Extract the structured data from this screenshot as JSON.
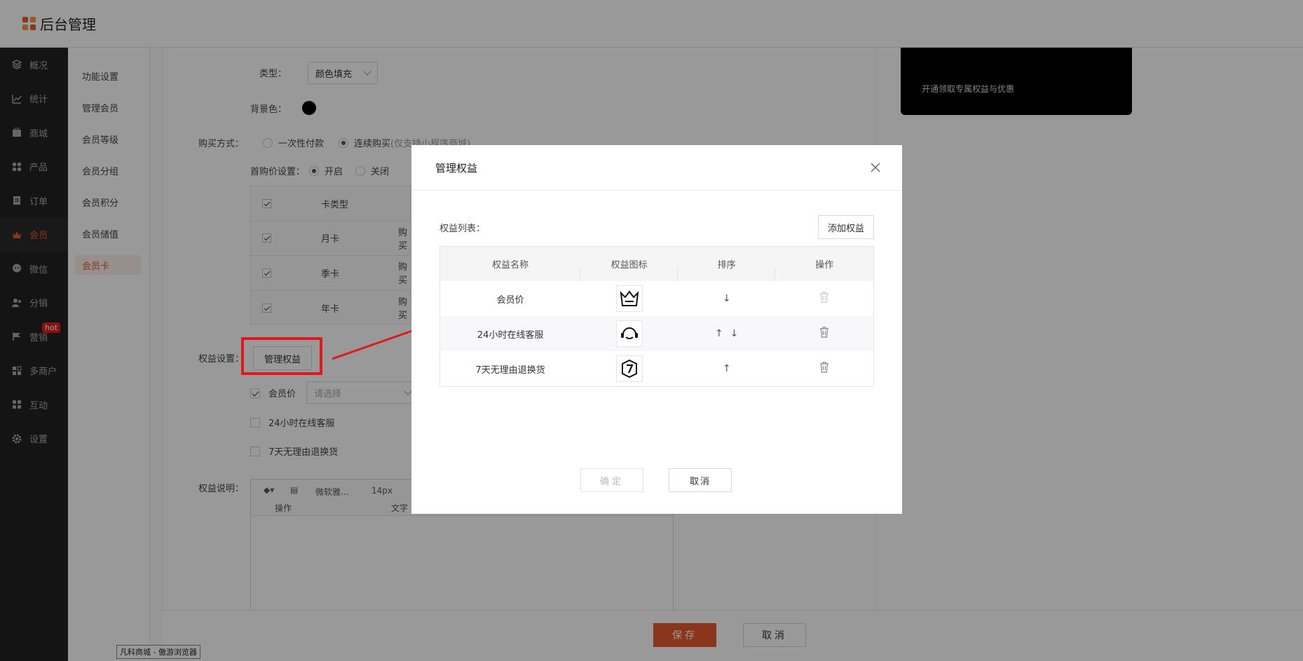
{
  "app": {
    "title": "后台管理"
  },
  "sidebar": {
    "items": [
      {
        "label": "概况",
        "icon": "layers-icon"
      },
      {
        "label": "统计",
        "icon": "chart-icon"
      },
      {
        "label": "商城",
        "icon": "shop-icon"
      },
      {
        "label": "产品",
        "icon": "grid-icon"
      },
      {
        "label": "订单",
        "icon": "order-icon"
      },
      {
        "label": "会员",
        "icon": "crown-icon",
        "active": true
      },
      {
        "label": "微信",
        "icon": "wechat-icon"
      },
      {
        "label": "分销",
        "icon": "users-icon"
      },
      {
        "label": "营销",
        "icon": "flag-icon",
        "badge": "hot"
      },
      {
        "label": "多商户",
        "icon": "merchants-icon"
      },
      {
        "label": "互动",
        "icon": "interact-icon"
      },
      {
        "label": "设置",
        "icon": "gear-icon"
      }
    ]
  },
  "subnav": {
    "items": [
      "功能设置",
      "管理会员",
      "会员等级",
      "会员分组",
      "会员积分",
      "会员储值",
      "会员卡"
    ]
  },
  "form": {
    "type_label": "类型：",
    "type_value": "颜色填充",
    "bg_label": "背景色：",
    "buy_label": "购买方式：",
    "buy_once": "一次性付款",
    "buy_continuous": "连续购买",
    "buy_hint": "(仅支持小程序商城)",
    "first_price_label": "首购价设置：",
    "first_on": "开启",
    "first_off": "关闭",
    "card_type_header": "卡类型",
    "cards": [
      "月卡",
      "季卡",
      "年卡"
    ],
    "card_buy_text": "购买",
    "benefit_label": "权益设置：",
    "manage_btn": "管理权益",
    "benefits": [
      "会员价",
      "24小时在线客服",
      "7天无理由退换货"
    ],
    "select_placeholder": "请选择",
    "desc_label": "权益说明：",
    "editor_font": "微软雅...",
    "editor_size": "14px",
    "editor_op": "操作",
    "editor_text": "文字"
  },
  "preview": {
    "text": "开通领取专属权益与优惠"
  },
  "footer": {
    "save": "保存",
    "cancel": "取消"
  },
  "status_tip": "凡科商城 - 傲游浏览器",
  "modal": {
    "title": "管理权益",
    "list_label": "权益列表：",
    "add_btn": "添加权益",
    "headers": [
      "权益名称",
      "权益图标",
      "排序",
      "操作"
    ],
    "rows": [
      {
        "name": "会员价",
        "icon": "crown-icon",
        "sort": [
          "↓"
        ]
      },
      {
        "name": "24小时在线客服",
        "icon": "headset-icon",
        "sort": [
          "↑",
          "↓"
        ]
      },
      {
        "name": "7天无理由退换货",
        "icon": "seven-day-icon",
        "sort": [
          "↑"
        ]
      }
    ],
    "ok": "确定",
    "cancel": "取消"
  },
  "colors": {
    "accent": "#e6592f",
    "highlight": "#e0191c",
    "sidebar_bg": "#222222"
  }
}
